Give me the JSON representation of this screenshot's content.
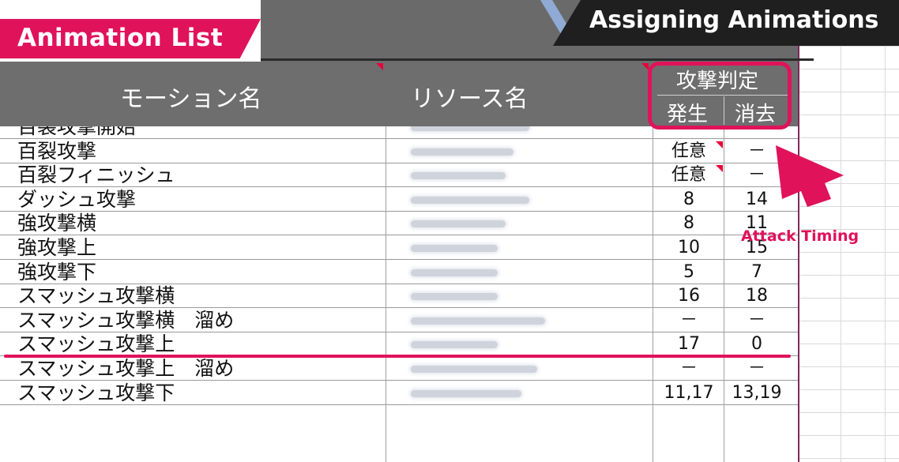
{
  "titles": {
    "left": "Animation List",
    "right": "Assigning Animations"
  },
  "columns": {
    "motion_name": "モーション名",
    "resource_name": "リソース名",
    "attack_judgement": "攻撃判定",
    "occur": "発生",
    "erase": "消去"
  },
  "annotation": {
    "attack_timing": "Attack Timing"
  },
  "rows": [
    {
      "name": "百裂攻撃開始",
      "occur": "",
      "erase": ""
    },
    {
      "name": "百裂攻撃",
      "occur": "任意",
      "erase": "－"
    },
    {
      "name": "百裂フィニッシュ",
      "occur": "任意",
      "erase": "－"
    },
    {
      "name": "ダッシュ攻撃",
      "occur": "8",
      "erase": "14"
    },
    {
      "name": "強攻撃横",
      "occur": "8",
      "erase": "11"
    },
    {
      "name": "強攻撃上",
      "occur": "10",
      "erase": "15"
    },
    {
      "name": "強攻撃下",
      "occur": "5",
      "erase": "7"
    },
    {
      "name": "スマッシュ攻撃横",
      "occur": "16",
      "erase": "18"
    },
    {
      "name": "スマッシュ攻撃横　溜め",
      "occur": "－",
      "erase": "－"
    },
    {
      "name": "スマッシュ攻撃上",
      "occur": "17",
      "erase": "0"
    },
    {
      "name": "スマッシュ攻撃上　溜め",
      "occur": "－",
      "erase": "－"
    },
    {
      "name": "スマッシュ攻撃下",
      "occur": "11,17",
      "erase": "13,19"
    }
  ],
  "colors": {
    "accent": "#e0125a",
    "header_gray": "#6e6e6e",
    "title_dark": "#1f1f1f"
  }
}
